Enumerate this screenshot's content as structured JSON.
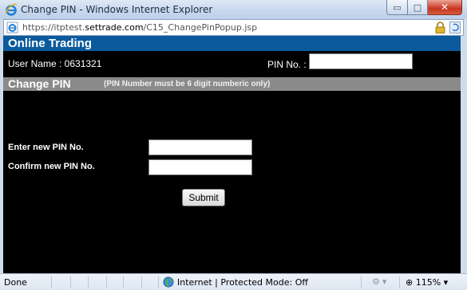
{
  "window": {
    "title": "Change PIN - Windows Internet Explorer",
    "min_glyph": "▭",
    "max_glyph": "□",
    "close_glyph": "✕"
  },
  "address": {
    "url_prefix": "https://itptest.",
    "url_domain": "settrade.com",
    "url_path": "/C15_ChangePinPopup.jsp"
  },
  "page": {
    "header": "Online Trading",
    "user_name": "User Name : 0631321",
    "pin_label": "PIN No. :",
    "pin_value": "",
    "section_title": "Change PIN",
    "section_note": "(PIN Number must be 6 digit numberic only)",
    "new_pin_label": "Enter new PIN No.",
    "new_pin_value": "",
    "confirm_pin_label": "Confirm new PIN No.",
    "confirm_pin_value": "",
    "submit_label": "Submit"
  },
  "status": {
    "text": "Done",
    "zone": "Internet | Protected Mode: Off",
    "addons_glyph": "⚙ ▾",
    "zoom": "⊕ 115%  ▾"
  },
  "colors": {
    "online_trading_header": "#0b5a9e",
    "change_pin_header": "#8a8a8a",
    "page_background": "#000000"
  }
}
